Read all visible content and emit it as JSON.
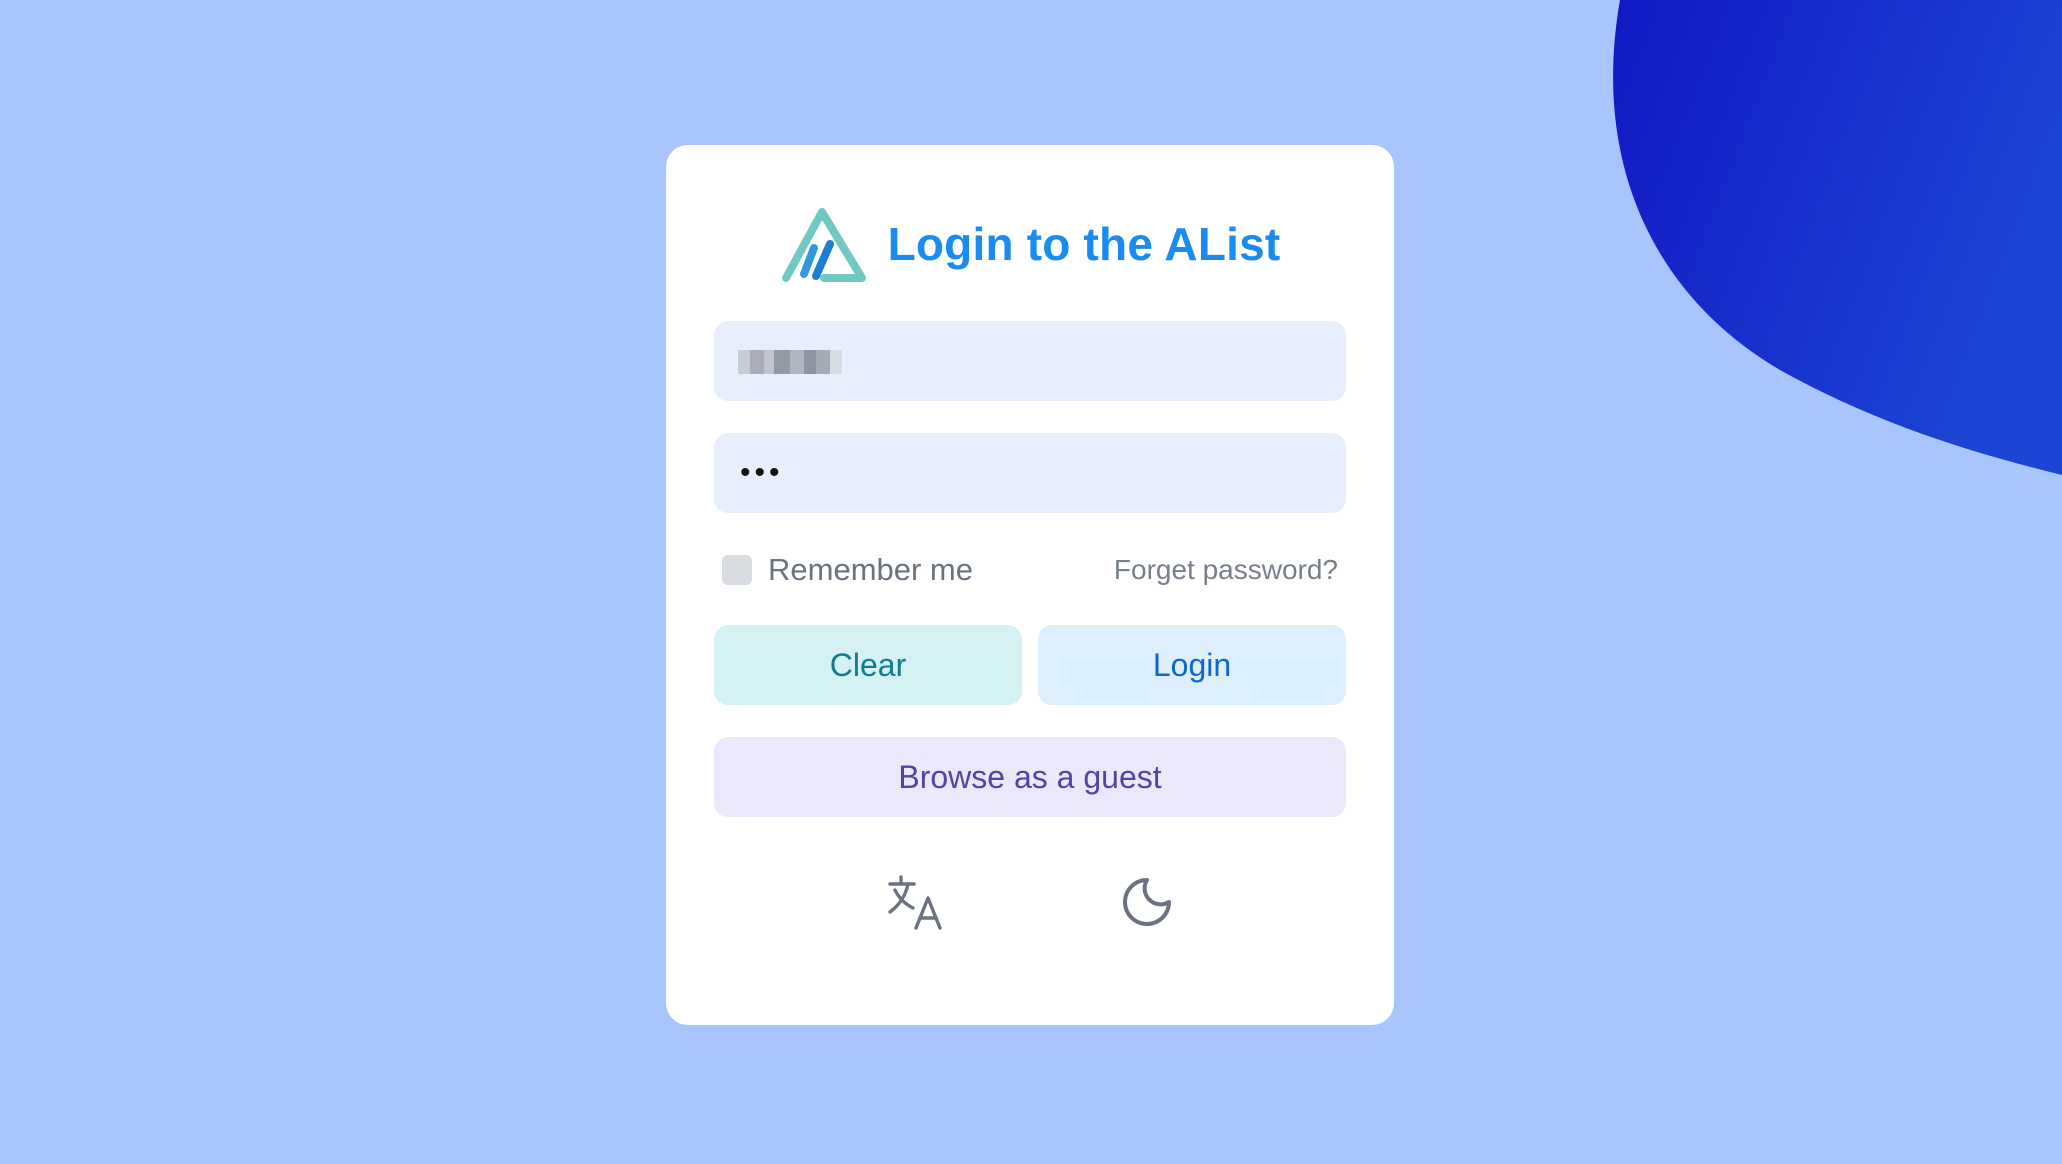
{
  "login": {
    "title": "Login to the AList",
    "username_value": "",
    "password_masked": "•••",
    "remember_label": "Remember me",
    "forget_label": "Forget password?",
    "clear_label": "Clear",
    "login_label": "Login",
    "guest_label": "Browse as a guest"
  },
  "icons": {
    "logo": "alist-logo",
    "language": "translate-icon",
    "theme": "moon-icon"
  },
  "colors": {
    "background": "#a9c5fd",
    "blob": "#1724c9",
    "title": "#1a8cf0",
    "clear_button": "#d6f1f4",
    "login_button": "#ddeefd",
    "guest_button": "#ebe8fc"
  }
}
